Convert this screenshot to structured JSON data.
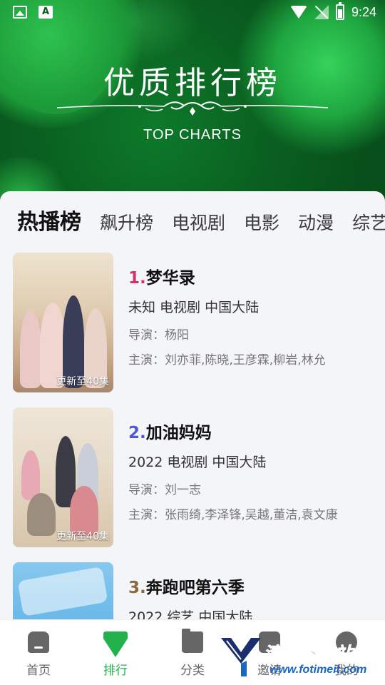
{
  "status_bar": {
    "time": "9:24"
  },
  "header": {
    "title": "优质排行榜",
    "subtitle": "TOP CHARTS"
  },
  "tabs": [
    {
      "label": "热播榜",
      "active": true
    },
    {
      "label": "飙升榜"
    },
    {
      "label": "电视剧"
    },
    {
      "label": "电影"
    },
    {
      "label": "动漫"
    },
    {
      "label": "综艺"
    }
  ],
  "items": [
    {
      "rank": "1.",
      "title": "梦华录",
      "meta": "未知  电视剧  中国大陆",
      "director": "导演：杨阳",
      "cast": "主演：刘亦菲,陈晓,王彦霖,柳岩,林允",
      "badge": "更新至40集"
    },
    {
      "rank": "2.",
      "title": "加油妈妈",
      "meta": "2022  电视剧  中国大陆",
      "director": "导演：刘一志",
      "cast": "主演：张雨绮,李泽锋,吴越,董洁,袁文康",
      "badge": "更新至40集"
    },
    {
      "rank": "3.",
      "title": "奔跑吧第六季",
      "meta": "2022  综艺  中国大陆"
    }
  ],
  "bottom_nav": [
    {
      "label": "首页",
      "icon": "home-icon"
    },
    {
      "label": "排行",
      "icon": "diamond-icon",
      "active": true
    },
    {
      "label": "分类",
      "icon": "folder-icon"
    },
    {
      "label": "邀请",
      "icon": "share-icon"
    },
    {
      "label": "我的",
      "icon": "user-icon"
    }
  ],
  "watermark": {
    "text": "清源下载站",
    "url": "www.fotimeit.com"
  },
  "colors": {
    "accent_green": "#22b14c",
    "rank1": "#d6336c",
    "rank2": "#4f55d9",
    "rank3": "#8a6a3d"
  }
}
